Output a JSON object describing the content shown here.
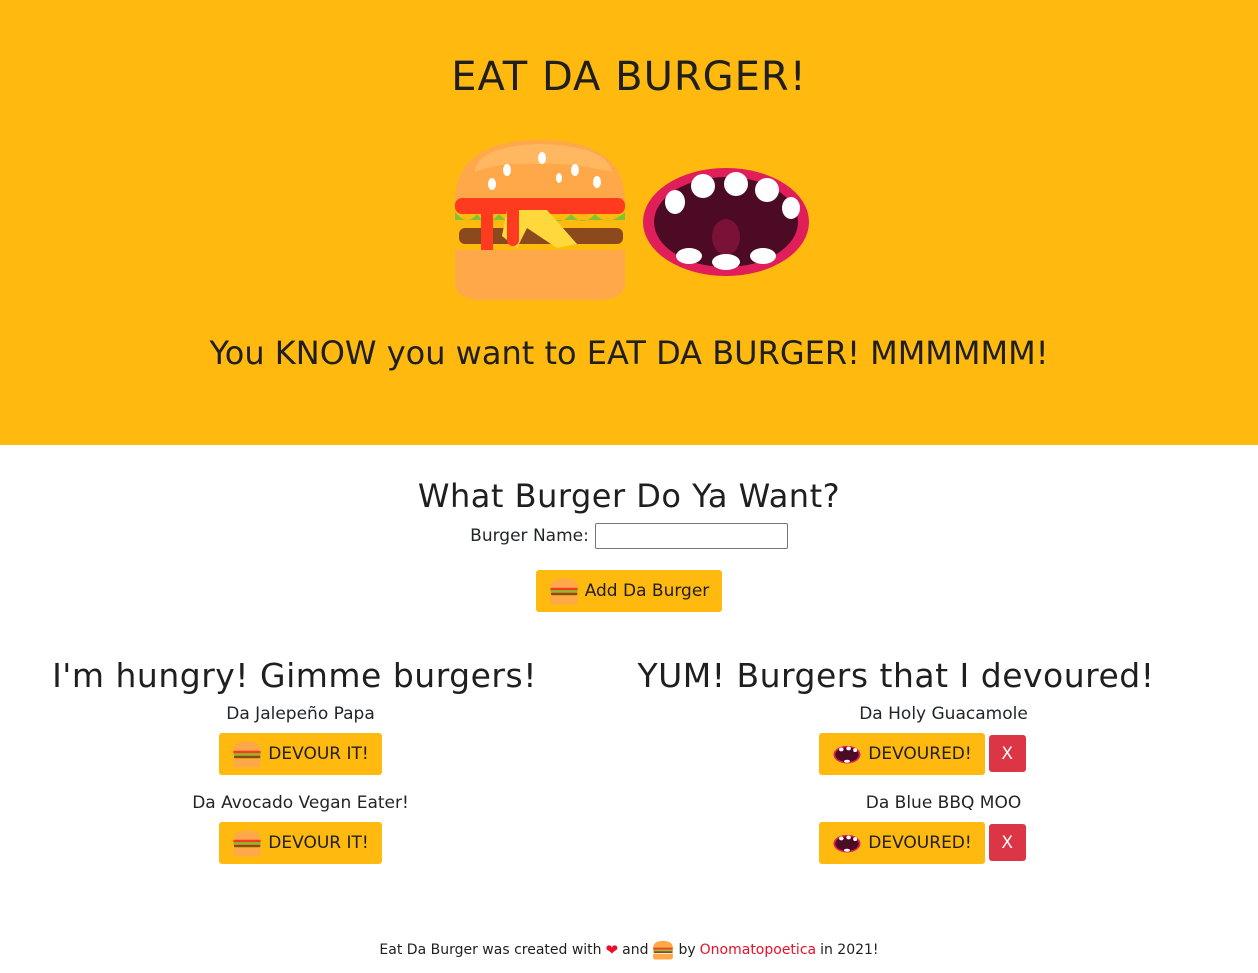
{
  "header": {
    "title": "EAT DA BURGER!",
    "tagline": "You KNOW you want to EAT DA BURGER! MMMMMM!"
  },
  "form": {
    "heading": "What Burger Do Ya Want?",
    "name_label": "Burger Name:",
    "name_value": "",
    "add_label": "Add Da Burger"
  },
  "uneaten": {
    "heading": "I'm hungry! Gimme burgers!",
    "button_label": "DEVOUR IT!",
    "items": [
      {
        "name": "Da Jalepeño Papa"
      },
      {
        "name": "Da Avocado Vegan Eater!"
      }
    ]
  },
  "devoured": {
    "heading": "YUM! Burgers that I devoured!",
    "button_label": "DEVOURED!",
    "delete_label": "X",
    "items": [
      {
        "name": "Da Holy Guacamole"
      },
      {
        "name": "Da Blue BBQ MOO"
      }
    ]
  },
  "footer": {
    "text_1": "Eat Da Burger was created with",
    "text_2": "and",
    "text_3": "by",
    "author": "Onomatopoetica",
    "text_4": "in 2021!"
  },
  "colors": {
    "accent": "#FFB90F",
    "danger": "#DC3545",
    "link": "#E8102A"
  },
  "icons": [
    "burger-icon",
    "mouth-icon",
    "heart-icon"
  ]
}
